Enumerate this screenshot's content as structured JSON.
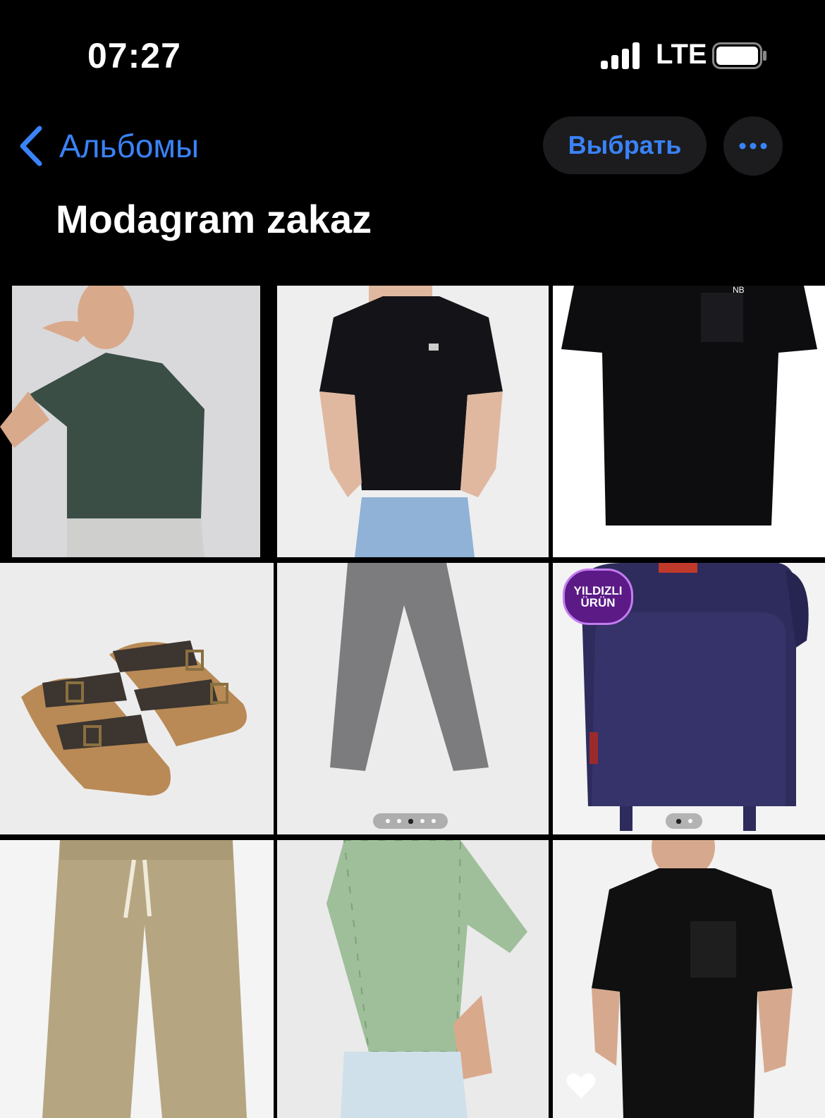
{
  "status_bar": {
    "time": "07:27",
    "network": "LTE"
  },
  "nav": {
    "back_label": "Альбомы",
    "select_label": "Выбрать"
  },
  "album": {
    "title": "Modagram zakaz"
  },
  "photos": [
    {
      "subject": "green polo shirt model",
      "colors": {
        "bg": "#d9d9db",
        "item": "#3a4e46"
      }
    },
    {
      "subject": "black t-shirt model",
      "colors": {
        "bg": "#eeeeee",
        "item": "#141418"
      }
    },
    {
      "subject": "black t-shirt with pocket",
      "colors": {
        "bg": "#ffffff",
        "item": "#0d0d10"
      }
    },
    {
      "subject": "brown sandals",
      "colors": {
        "bg": "#ececec",
        "item": "#3c3530"
      }
    },
    {
      "subject": "grey trousers",
      "colors": {
        "bg": "#ececec",
        "item": "#7c7c7f"
      },
      "page_dots": {
        "count": 5,
        "active": 2
      }
    },
    {
      "subject": "navy backpack",
      "colors": {
        "bg": "#f3f3f3",
        "item": "#2e2c5c"
      },
      "badge": {
        "line1": "YILDIZLI",
        "line2": "ÜRÜN"
      },
      "page_dots": {
        "count": 2,
        "active": 0
      }
    },
    {
      "subject": "beige chino trousers",
      "colors": {
        "bg": "#f4f4f4",
        "item": "#b5a581"
      }
    },
    {
      "subject": "green check shirt model",
      "colors": {
        "bg": "#eaeaea",
        "item": "#9fbf9a"
      }
    },
    {
      "subject": "black t-shirt with pocket model",
      "colors": {
        "bg": "#f2f2f2",
        "item": "#101010"
      },
      "favorite": true
    }
  ],
  "colors": {
    "accent": "#3a82f7",
    "button_bg": "#1c1c1e",
    "background": "#000000"
  },
  "icons": [
    "signal-icon",
    "battery-icon",
    "chevron-left-icon",
    "more-icon",
    "heart-icon"
  ]
}
